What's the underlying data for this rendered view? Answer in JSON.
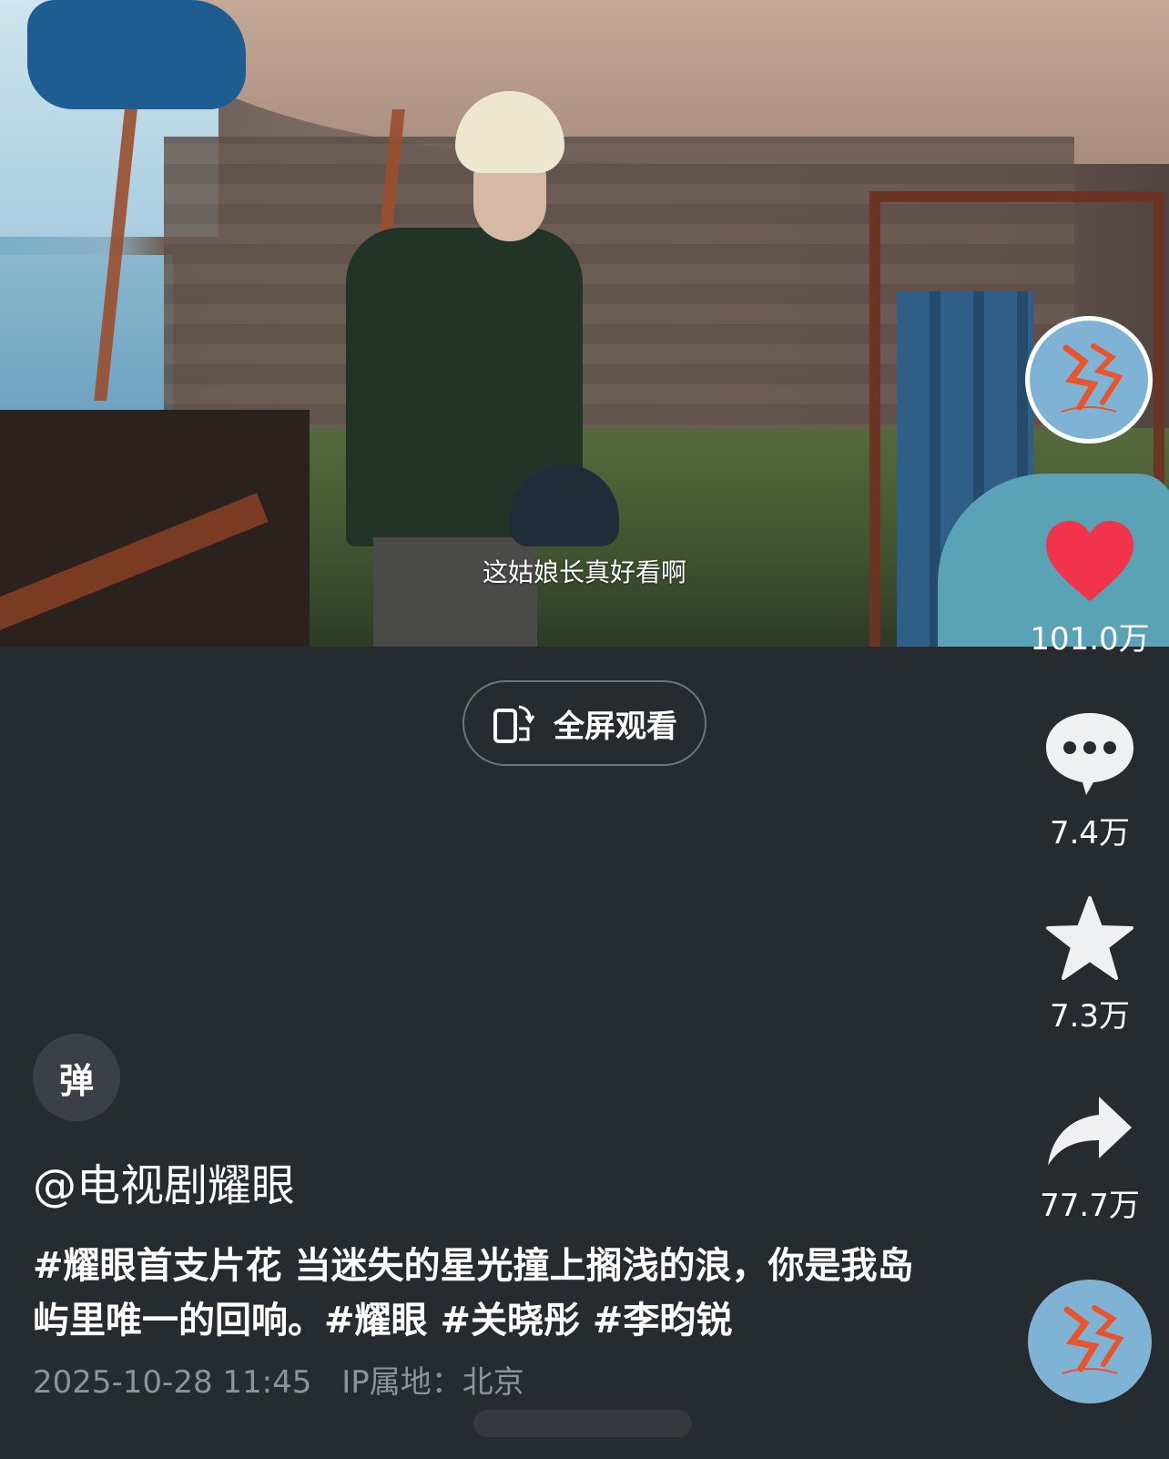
{
  "video": {
    "subtitle": "这姑娘长真好看啊",
    "fullscreen_label": "全屏观看"
  },
  "sidebar": {
    "likes": "101.0万",
    "comments": "7.4万",
    "favorites": "7.3万",
    "shares": "77.7万",
    "like_color": "#f2334c"
  },
  "post": {
    "danmu_label": "弹",
    "author": "@电视剧耀眼",
    "caption": "#耀眼首支片花 当迷失的星光撞上搁浅的浪，你是我岛屿里唯一的回响。#耀眼 #关晓彤 #李昀锐",
    "timestamp": "2025-10-28 11:45",
    "ip_location": "IP属地：北京"
  },
  "colors": {
    "background": "#262b30",
    "avatar_bg": "#7fb3d6",
    "logo": "#e8552c"
  }
}
